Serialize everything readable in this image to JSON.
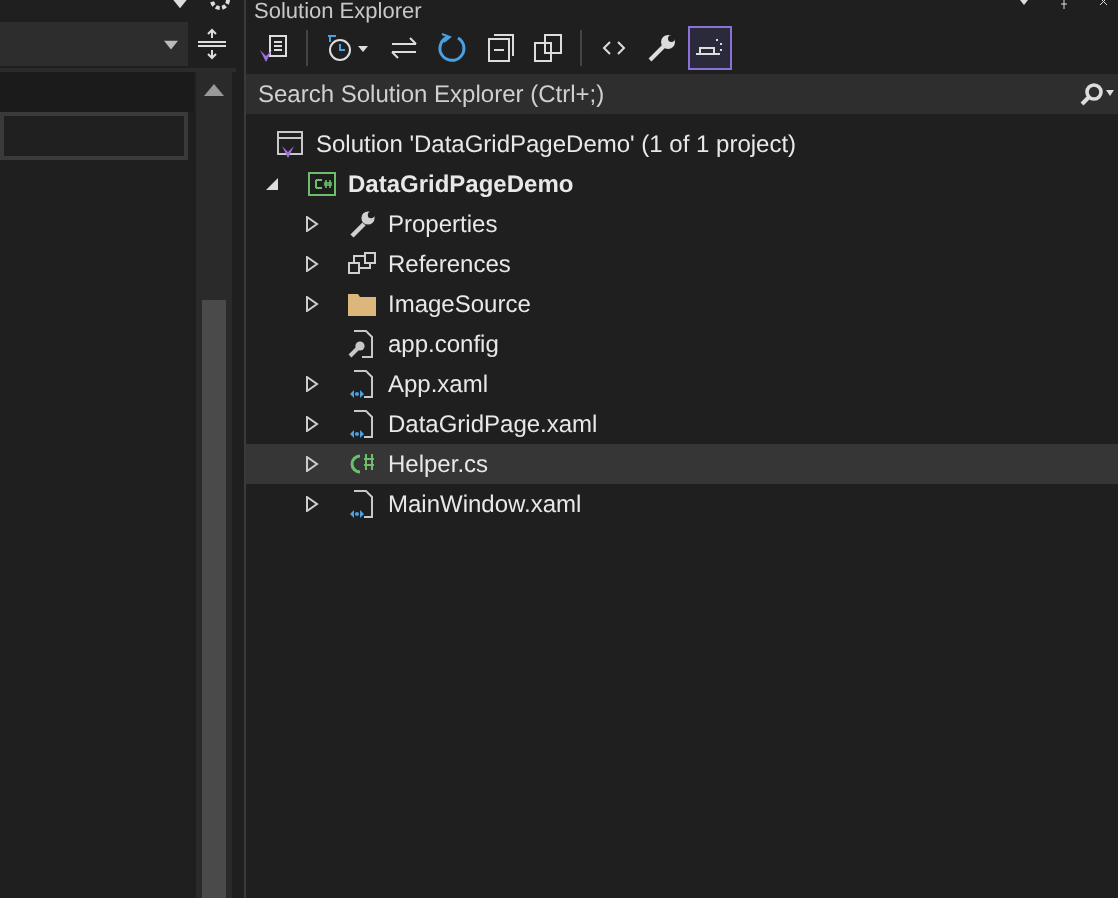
{
  "panel": {
    "title": "Solution Explorer"
  },
  "toolbar": [
    {
      "kind": "solution",
      "selected": false
    },
    {
      "kind": "history",
      "selected": false
    },
    {
      "kind": "sync",
      "selected": false
    },
    {
      "kind": "refresh",
      "selected": false
    },
    {
      "kind": "collapse",
      "selected": false
    },
    {
      "kind": "pages",
      "selected": false
    },
    {
      "kind": "code",
      "selected": false
    },
    {
      "kind": "wrench",
      "selected": false
    },
    {
      "kind": "pending",
      "selected": true
    }
  ],
  "search": {
    "placeholder": "Search Solution Explorer (Ctrl+;)"
  },
  "tree": {
    "label": "Solution 'DataGridPageDemo' (1 of 1 project)",
    "kind": "solution",
    "children": [
      {
        "label": "DataGridPageDemo",
        "kind": "csproj",
        "expanded": true,
        "selected": false,
        "children": [
          {
            "label": "Properties",
            "kind": "wrench",
            "expanded": false,
            "selected": false
          },
          {
            "label": "References",
            "kind": "references",
            "expanded": false,
            "selected": false
          },
          {
            "label": "ImageSource",
            "kind": "folder",
            "expanded": false,
            "selected": false
          },
          {
            "label": "app.config",
            "kind": "config",
            "selected": false
          },
          {
            "label": "App.xaml",
            "kind": "xaml",
            "expanded": false,
            "selected": false
          },
          {
            "label": "DataGridPage.xaml",
            "kind": "xaml",
            "expanded": false,
            "selected": false
          },
          {
            "label": "Helper.cs",
            "kind": "csharp",
            "expanded": false,
            "selected": true
          },
          {
            "label": "MainWindow.xaml",
            "kind": "xaml",
            "expanded": false,
            "selected": false
          }
        ]
      }
    ]
  }
}
